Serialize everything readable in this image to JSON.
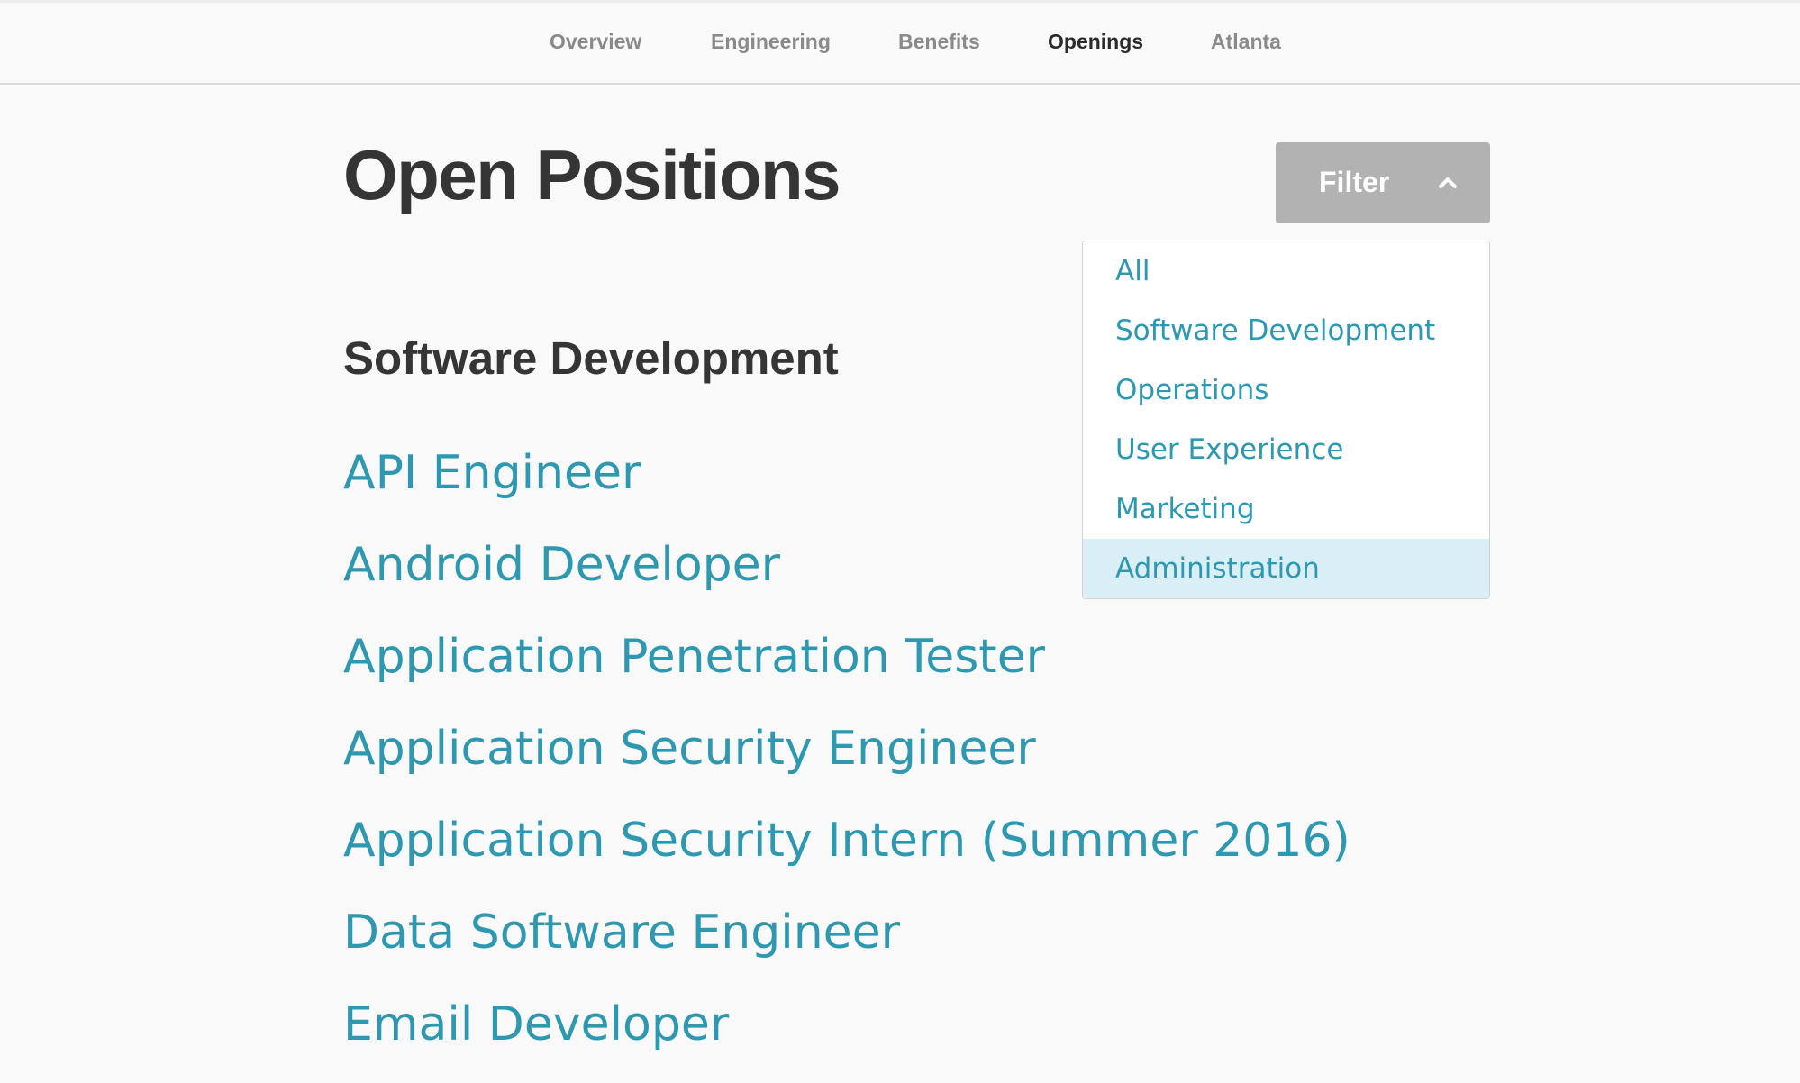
{
  "nav": {
    "items": [
      {
        "label": "Overview"
      },
      {
        "label": "Engineering"
      },
      {
        "label": "Benefits"
      },
      {
        "label": "Openings"
      },
      {
        "label": "Atlanta"
      }
    ],
    "active": "Openings"
  },
  "header": {
    "title": "Open Positions",
    "filter_label": "Filter",
    "filter_icon": "chevron-up-icon"
  },
  "filter_menu": {
    "options": [
      "All",
      "Software Development",
      "Operations",
      "User Experience",
      "Marketing",
      "Administration"
    ],
    "highlighted": "Administration"
  },
  "section": {
    "heading": "Software Development",
    "jobs": [
      "API Engineer",
      "Android Developer",
      "Application Penetration Tester",
      "Application Security Engineer",
      "Application Security Intern (Summer 2016)",
      "Data Software Engineer",
      "Email Developer"
    ]
  },
  "colors": {
    "background": "#f9f9f9",
    "link": "#2e98b0",
    "heading": "#353535",
    "nav_inactive": "#8a8a8a",
    "filter_button": "#b2b2b2",
    "highlight": "#d9eff5"
  }
}
